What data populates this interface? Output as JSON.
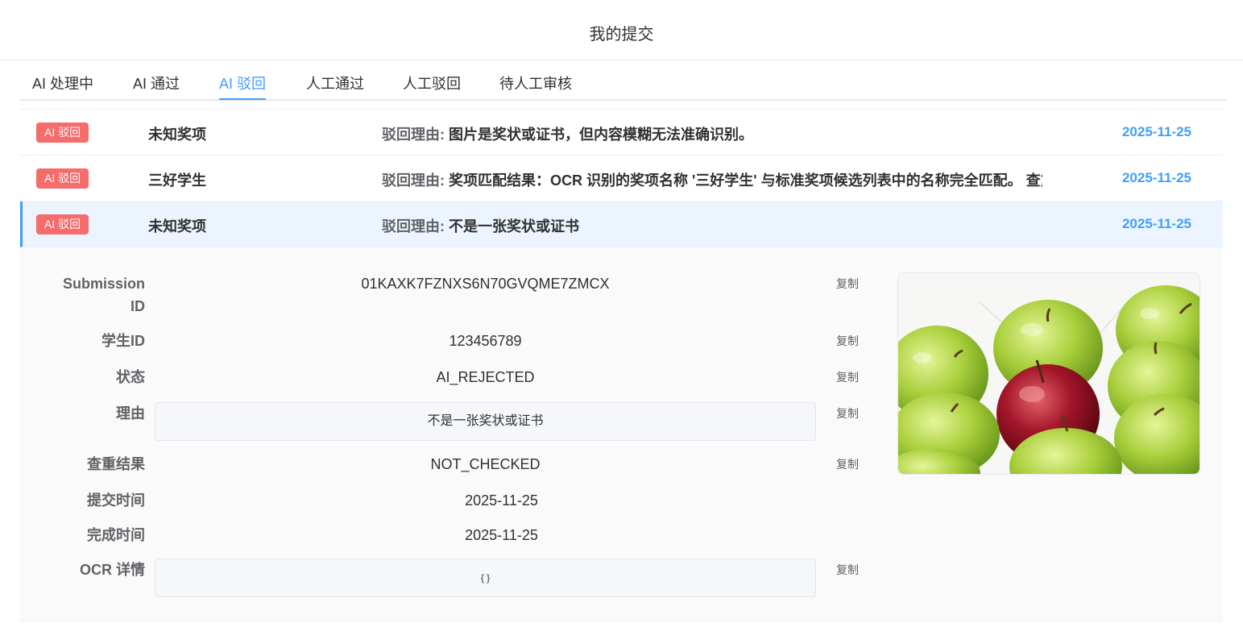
{
  "header": {
    "title": "我的提交"
  },
  "tabs": [
    {
      "label": "AI 处理中"
    },
    {
      "label": "AI 通过"
    },
    {
      "label": "AI 驳回"
    },
    {
      "label": "人工通过"
    },
    {
      "label": "人工驳回"
    },
    {
      "label": "待人工审核"
    }
  ],
  "active_tab": "AI 驳回",
  "reason_label": "驳回理由:",
  "submissions": [
    {
      "badge": "AI 驳回",
      "award": "未知奖项",
      "reason": "图片是奖状或证书，但内容模糊无法准确识别。",
      "date": "2025-11-25"
    },
    {
      "badge": "AI 驳回",
      "award": "三好学生",
      "reason": "奖项匹配结果：OCR 识别的奖项名称 '三好学生' 与标准奖项候选列表中的名称完全匹配。 查重结果",
      "date": "2025-11-25"
    },
    {
      "badge": "AI 驳回",
      "award": "未知奖项",
      "reason": "不是一张奖状或证书",
      "date": "2025-11-25"
    }
  ],
  "detail": {
    "copy_label": "复制",
    "submission_id": {
      "label": "Submission ID",
      "value": "01KAXK7FZNXS6N70GVQME7ZMCX"
    },
    "student_id": {
      "label": "学生ID",
      "value": "123456789"
    },
    "status": {
      "label": "状态",
      "value": "AI_REJECTED"
    },
    "reason": {
      "label": "理由",
      "value": "不是一张奖状或证书"
    },
    "dup_check": {
      "label": "查重结果",
      "value": "NOT_CHECKED"
    },
    "submit_time": {
      "label": "提交时间",
      "value": "2025-11-25"
    },
    "complete_time": {
      "label": "完成时间",
      "value": "2025-11-25"
    },
    "ocr": {
      "label": "OCR 详情",
      "value": "{ }"
    }
  },
  "colors": {
    "accent": "#409eff",
    "badge": "#f56c6c",
    "active_row_bg": "#ecf5ff"
  }
}
